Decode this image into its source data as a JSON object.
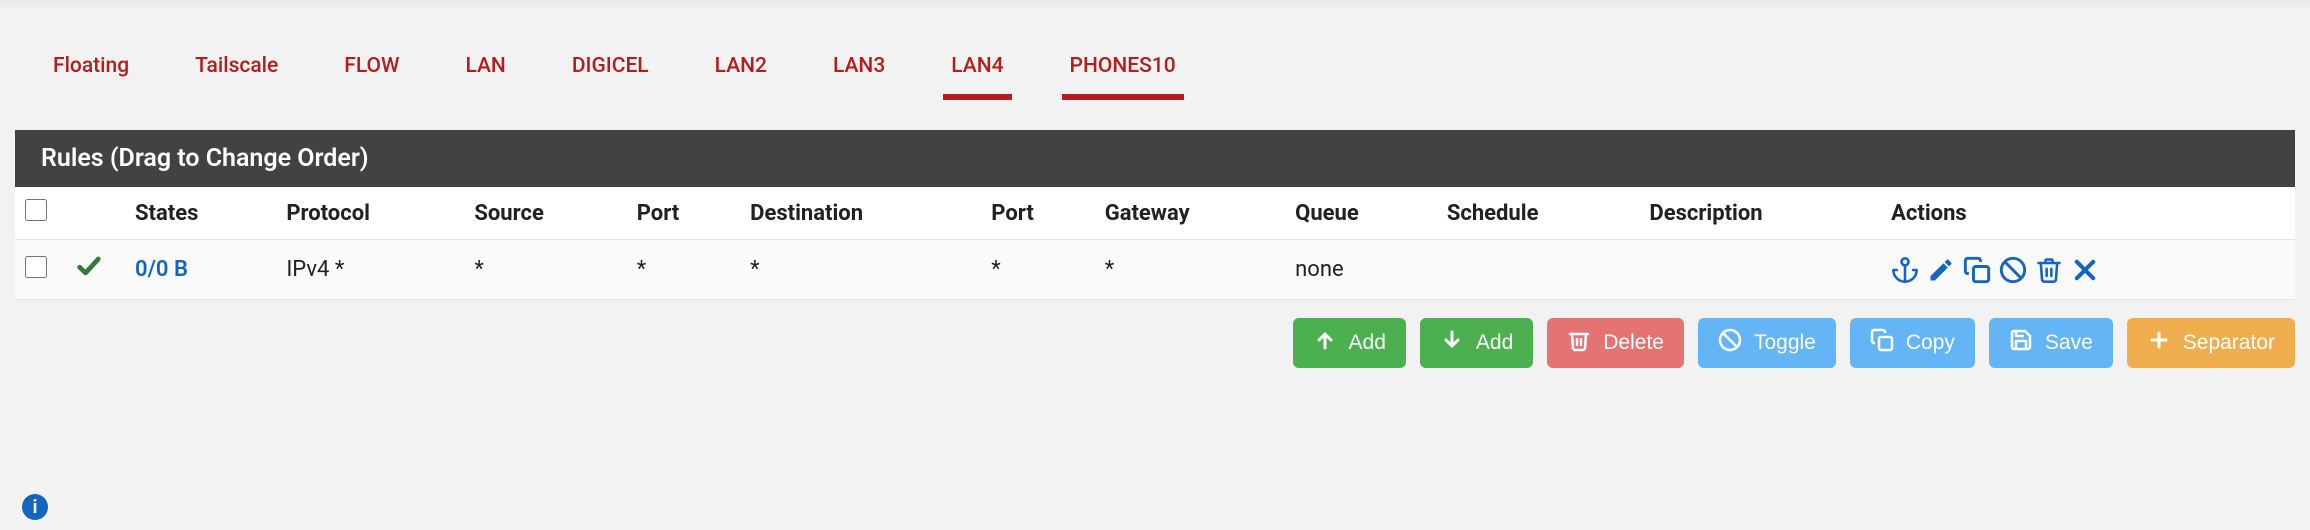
{
  "tabs": [
    {
      "label": "Floating",
      "active": false
    },
    {
      "label": "Tailscale",
      "active": false
    },
    {
      "label": "FLOW",
      "active": false
    },
    {
      "label": "LAN",
      "active": false
    },
    {
      "label": "DIGICEL",
      "active": false
    },
    {
      "label": "LAN2",
      "active": false
    },
    {
      "label": "LAN3",
      "active": false
    },
    {
      "label": "LAN4",
      "active": true
    },
    {
      "label": "PHONES10",
      "active": true
    }
  ],
  "panel": {
    "title": "Rules (Drag to Change Order)"
  },
  "columns": {
    "states": "States",
    "protocol": "Protocol",
    "source": "Source",
    "port1": "Port",
    "destination": "Destination",
    "port2": "Port",
    "gateway": "Gateway",
    "queue": "Queue",
    "schedule": "Schedule",
    "description": "Description",
    "actions": "Actions"
  },
  "rows": [
    {
      "state_icon": "pass",
      "states": "0/0 B",
      "protocol": "IPv4 *",
      "source": "*",
      "port1": "*",
      "destination": "*",
      "port2": "*",
      "gateway": "*",
      "queue": "none",
      "schedule": "",
      "description": ""
    }
  ],
  "buttons": {
    "add_top": "Add",
    "add_bottom": "Add",
    "delete": "Delete",
    "toggle": "Toggle",
    "copy": "Copy",
    "save": "Save",
    "separator": "Separator"
  },
  "icons": {
    "anchor": "anchor-icon",
    "edit": "pencil-icon",
    "copy": "copy-icon",
    "disable": "ban-icon",
    "delete": "trash-icon",
    "close": "x-icon"
  },
  "colors": {
    "brand_red": "#b71c1c",
    "link_blue": "#1565c0",
    "pass_green": "#2e7d32",
    "btn_green": "#4caf50",
    "btn_red": "#e57373",
    "btn_blue": "#64b5f6",
    "btn_orange": "#f0ad4e"
  }
}
